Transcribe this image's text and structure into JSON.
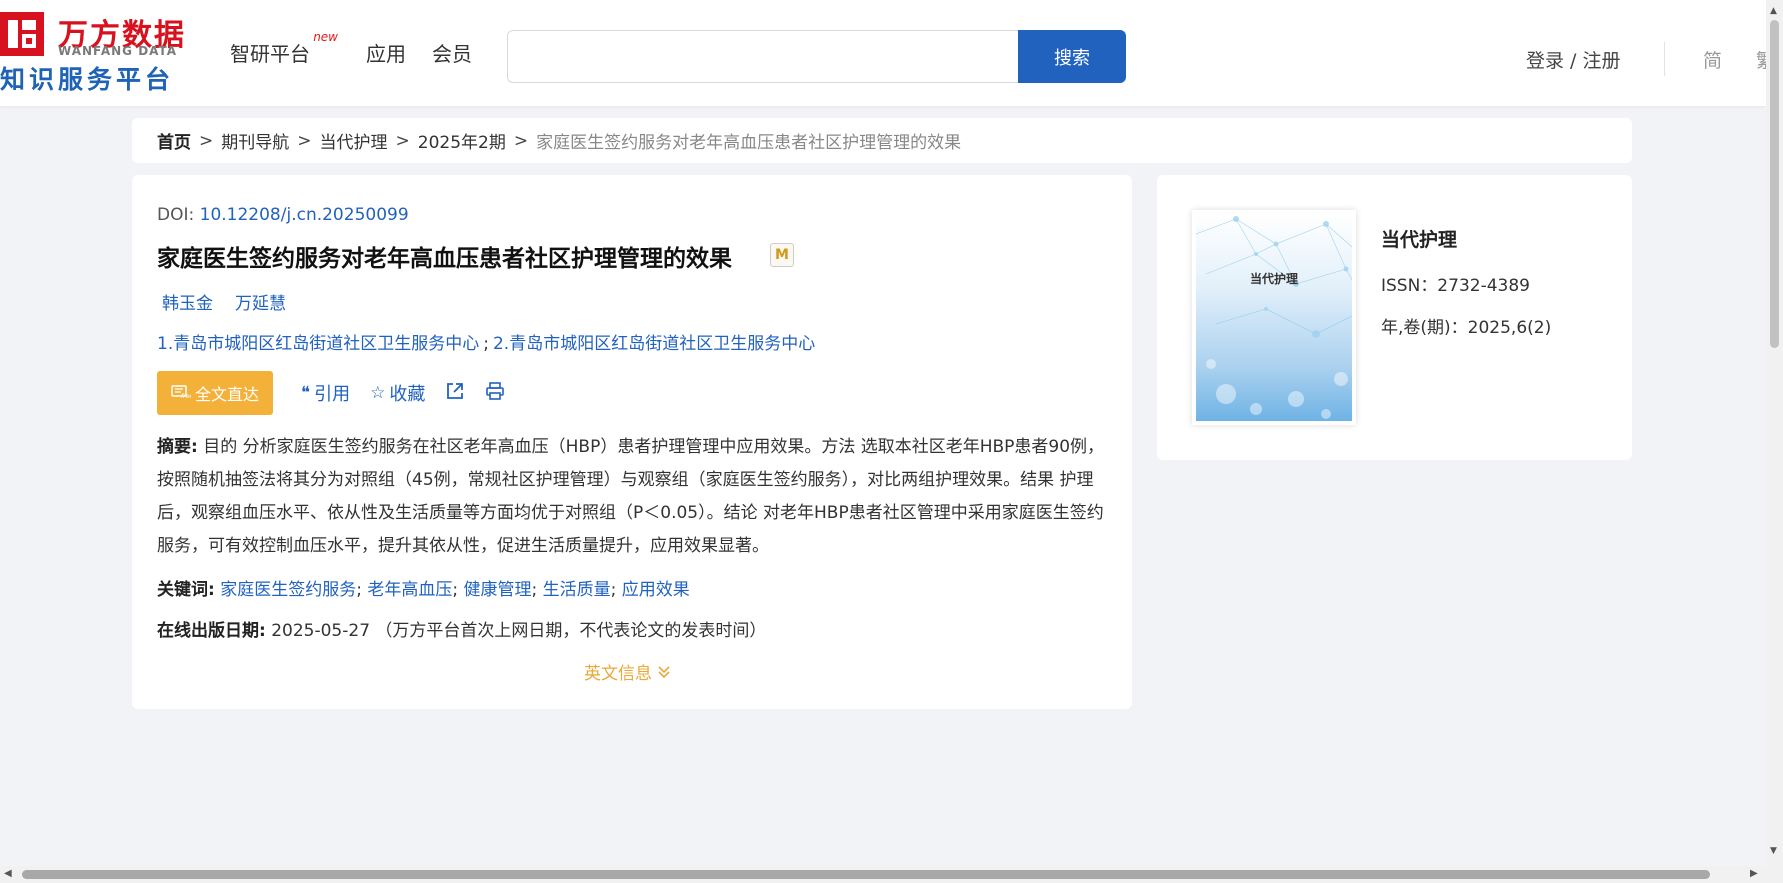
{
  "header": {
    "logo_cn": "万方数据",
    "logo_en": "WANFANG DATA",
    "logo_sub": "知识服务平台",
    "nav": [
      {
        "label": "智研平台",
        "badge": "new"
      },
      {
        "label": "应用"
      },
      {
        "label": "会员"
      }
    ],
    "search": {
      "value": "",
      "placeholder": "",
      "button": "搜索"
    },
    "login": "登录 / 注册",
    "lang_simplified": "简",
    "lang_traditional": "繁"
  },
  "breadcrumb": {
    "home": "首页",
    "items": [
      "期刊导航",
      "当代护理",
      "2025年2期"
    ],
    "current": "家庭医生签约服务对老年高血压患者社区护理管理的效果",
    "separator": ">"
  },
  "article": {
    "doi_label": "DOI: ",
    "doi": "10.12208/j.cn.20250099",
    "title": "家庭医生签约服务对老年高血压患者社区护理管理的效果",
    "m_badge": "M",
    "authors": [
      "韩玉金",
      "万延慧"
    ],
    "affiliations": [
      "1.青岛市城阳区红岛街道社区卫生服务中心",
      "2.青岛市城阳区红岛街道社区卫生服务中心"
    ],
    "affiliation_separator": ";",
    "actions": {
      "fulltext": "全文直达",
      "fulltext_icon": "free",
      "cite": "引用",
      "favorite": "收藏"
    },
    "abstract_label": "摘要:",
    "abstract": "目的 分析家庭医生签约服务在社区老年高血压（HBP）患者护理管理中应用效果。方法 选取本社区老年HBP患者90例，按照随机抽签法将其分为对照组（45例，常规社区护理管理）与观察组（家庭医生签约服务），对比两组护理效果。结果 护理后，观察组血压水平、依从性及生活质量等方面均优于对照组（P＜0.05）。结论 对老年HBP患者社区管理中采用家庭医生签约服务，可有效控制血压水平，提升其依从性，促进生活质量提升，应用效果显著。",
    "keywords_label": "关键词:",
    "keywords": [
      "家庭医生签约服务",
      "老年高血压",
      "健康管理",
      "生活质量",
      "应用效果"
    ],
    "pubdate_label": "在线出版日期:",
    "pubdate": "2025-05-27",
    "pubdate_note": "（万方平台首次上网日期，不代表论文的发表时间）",
    "english_info": "英文信息"
  },
  "journal": {
    "cover_title": "当代护理",
    "name": "当代护理",
    "issn": "ISSN：2732-4389",
    "volume": "年,卷(期)：2025,6(2)"
  }
}
